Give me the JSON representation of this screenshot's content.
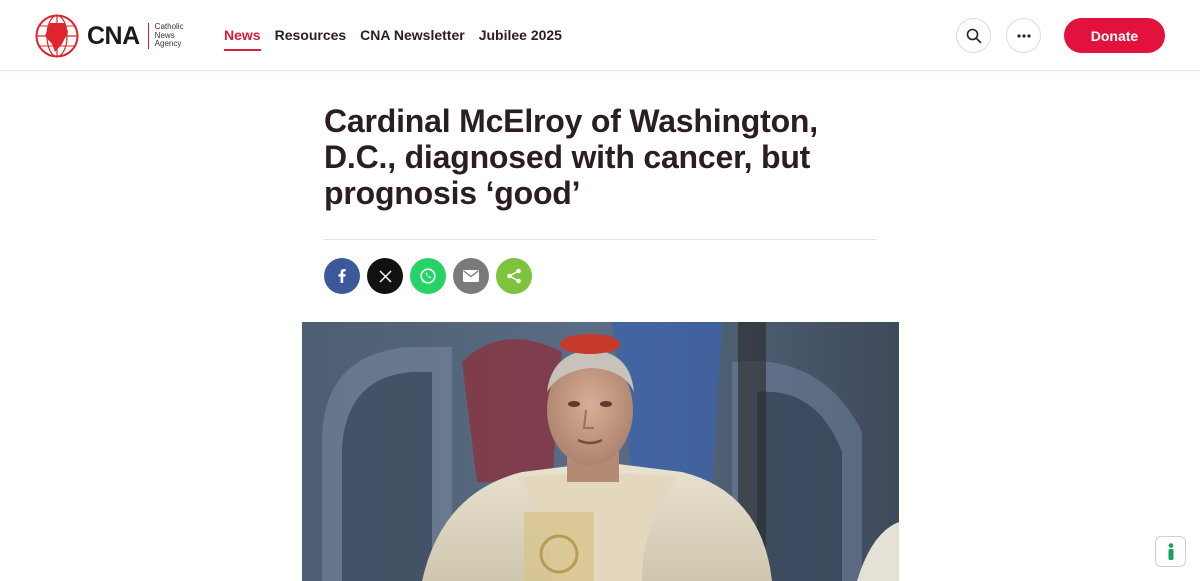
{
  "brand": {
    "name": "CNA",
    "sub_line1": "Catholic",
    "sub_line2": "News",
    "sub_line3": "Agency",
    "accent": "#e0242c"
  },
  "nav": {
    "items": [
      {
        "label": "News",
        "active": true
      },
      {
        "label": "Resources",
        "active": false
      },
      {
        "label": "CNA Newsletter",
        "active": false
      },
      {
        "label": "Jubilee 2025",
        "active": false
      }
    ]
  },
  "header": {
    "search_icon": "search-icon",
    "more_icon": "more-horizontal-icon",
    "donate_label": "Donate",
    "donate_color": "#e3123c"
  },
  "article": {
    "title": "Cardinal McElroy of Washington, D.C., diagnosed with cancer, but prognosis ‘good’",
    "share": [
      {
        "name": "facebook-icon",
        "color": "#3b5998"
      },
      {
        "name": "x-icon",
        "color": "#111111"
      },
      {
        "name": "whatsapp-icon",
        "color": "#25d366"
      },
      {
        "name": "email-icon",
        "color": "#7a7a7a"
      },
      {
        "name": "share-icon",
        "color": "#7dc33b"
      }
    ]
  },
  "accessibility": {
    "icon": "accessibility-icon"
  }
}
